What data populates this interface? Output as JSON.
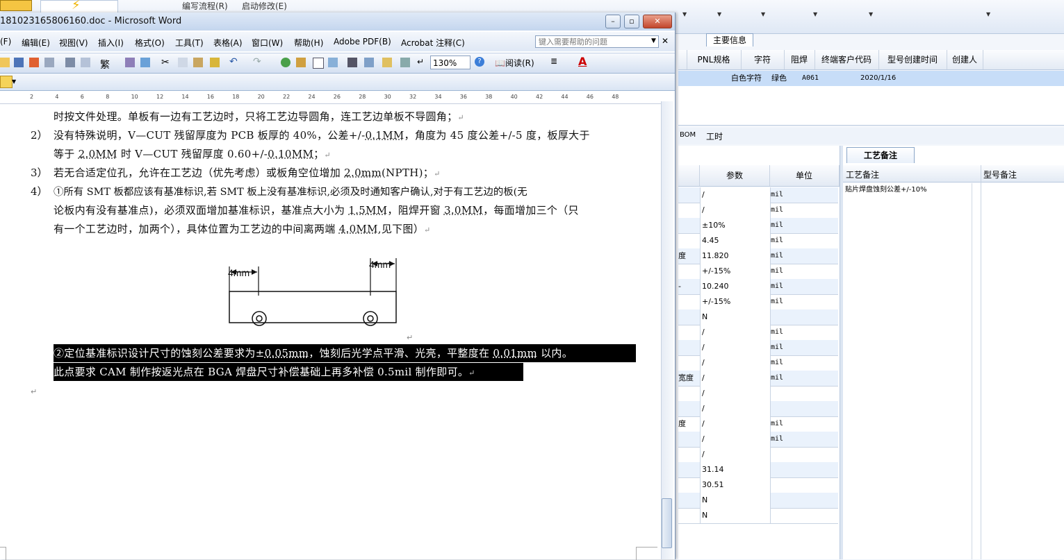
{
  "erp": {
    "menu": [
      "编写流程(R)",
      "启动修改(E)"
    ],
    "main_tab": "主要信息",
    "grid1_headers": [
      "PNL规格",
      "字符",
      "阻焊",
      "终端客户代码",
      "型号创建时间",
      "创建人"
    ],
    "grid1_row": {
      "char": "白色字符",
      "mask": "绿色",
      "customer": "A061",
      "created": "2020/1/16"
    },
    "tabs2": [
      "BOM",
      "工时"
    ],
    "param_headers": [
      "参数",
      "单位"
    ],
    "params": [
      {
        "label": "",
        "value": "/",
        "unit": "mil"
      },
      {
        "label": "",
        "value": "/",
        "unit": "mil"
      },
      {
        "label": "",
        "value": "±10%",
        "unit": "mil"
      },
      {
        "label": "",
        "value": "4.45",
        "unit": "mil"
      },
      {
        "label": "度",
        "value": "11.820",
        "unit": "mil"
      },
      {
        "label": "",
        "value": "+/-15%",
        "unit": "mil"
      },
      {
        "label": "-",
        "value": "10.240",
        "unit": "mil"
      },
      {
        "label": "",
        "value": "+/-15%",
        "unit": "mil"
      },
      {
        "label": "",
        "value": "N",
        "unit": ""
      },
      {
        "label": "",
        "value": "/",
        "unit": "mil"
      },
      {
        "label": "",
        "value": "/",
        "unit": "mil"
      },
      {
        "label": "",
        "value": "/",
        "unit": "mil"
      },
      {
        "label": "宽度",
        "value": "/",
        "unit": "mil"
      },
      {
        "label": "",
        "value": "/",
        "unit": ""
      },
      {
        "label": "",
        "value": "/",
        "unit": ""
      },
      {
        "label": "度",
        "value": "/",
        "unit": "mil"
      },
      {
        "label": "",
        "value": "/",
        "unit": "mil"
      },
      {
        "label": "",
        "value": "/",
        "unit": ""
      },
      {
        "label": "",
        "value": "31.14",
        "unit": ""
      },
      {
        "label": "",
        "value": "30.51",
        "unit": ""
      },
      {
        "label": "",
        "value": "N",
        "unit": ""
      },
      {
        "label": "",
        "value": "N",
        "unit": ""
      }
    ],
    "right_tab": "工艺备注",
    "right_headers": [
      "工艺备注",
      "型号备注"
    ],
    "right_note": "贴片焊盘蚀刻公差+/-10%"
  },
  "word": {
    "title": "181023165806160.doc - Microsoft Word",
    "menus": [
      "(F)",
      "编辑(E)",
      "视图(V)",
      "插入(I)",
      "格式(O)",
      "工具(T)",
      "表格(A)",
      "窗口(W)",
      "帮助(H)",
      "Adobe PDF(B)",
      "Acrobat 注释(C)"
    ],
    "help_placeholder": "键入需要帮助的问题",
    "zoom": "130%",
    "read_label": "阅读(R)",
    "ruler": [
      "2",
      "4",
      "6",
      "8",
      "10",
      "12",
      "14",
      "16",
      "18",
      "20",
      "22",
      "24",
      "26",
      "28",
      "30",
      "32",
      "34",
      "36",
      "38",
      "40",
      "42",
      "44",
      "46",
      "48"
    ],
    "doc": {
      "l0": "时按文件处理。单板有一边有工艺边时，只将工艺边导圆角，连工艺边单板不导圆角；",
      "n2": "2）",
      "l2a": "没有特殊说明，V—CUT 残留厚度为 PCB 板厚的 40%，公差+/-",
      "l2a_u": "0.1MM",
      "l2a_b": "，角度为 45 度公差+/-5 度，板厚大于",
      "l2b_a": "等于 ",
      "l2b_u": "2.0MM",
      "l2b_b": " 时 V—CUT 残留厚度 0.60+/-",
      "l2b_u2": "0.10MM",
      "l2b_c": "；",
      "n3": "3）",
      "l3a": "若无合适定位孔，允许在工艺边（优先考虑）或板角空位增加 ",
      "l3u": "2.0mm",
      "l3b": "(NPTH)；",
      "n4": "4）",
      "l4a": "①所有 SMT 板都应该有基准标识,若 SMT 板上没有基准标识,必须及时通知客户确认,对于有工艺边的板(无",
      "l4b_a": "论板内有没有基准点)，必须双面增加基准标识，基准点大小为 ",
      "l4b_u": "1.5MM",
      "l4b_b": "，阻焊开窗 ",
      "l4b_u2": "3.0MM",
      "l4b_c": "，每面增加三个（只",
      "l4c_a": "有一个工艺边时，加两个），具体位置为工艺边的中间离两端 ",
      "l4c_u": "4.0MM",
      "l4c_b": ",见下图）",
      "fig_left": "4mm",
      "fig_right": "4mm",
      "hl1_a": "②定位基准标识设计尺寸的蚀刻公差要求为±",
      "hl1_u": "0.05mm",
      "hl1_b": "，蚀刻后光学点平滑、光亮，平整度在 ",
      "hl1_u2": "0.01mm",
      "hl1_c": " 以内。",
      "hl2": "此点要求 CAM 制作按返光点在 BGA 焊盘尺寸补偿基础上再多补偿 0.5mil 制作即可。",
      "para_mark": "↵"
    }
  }
}
